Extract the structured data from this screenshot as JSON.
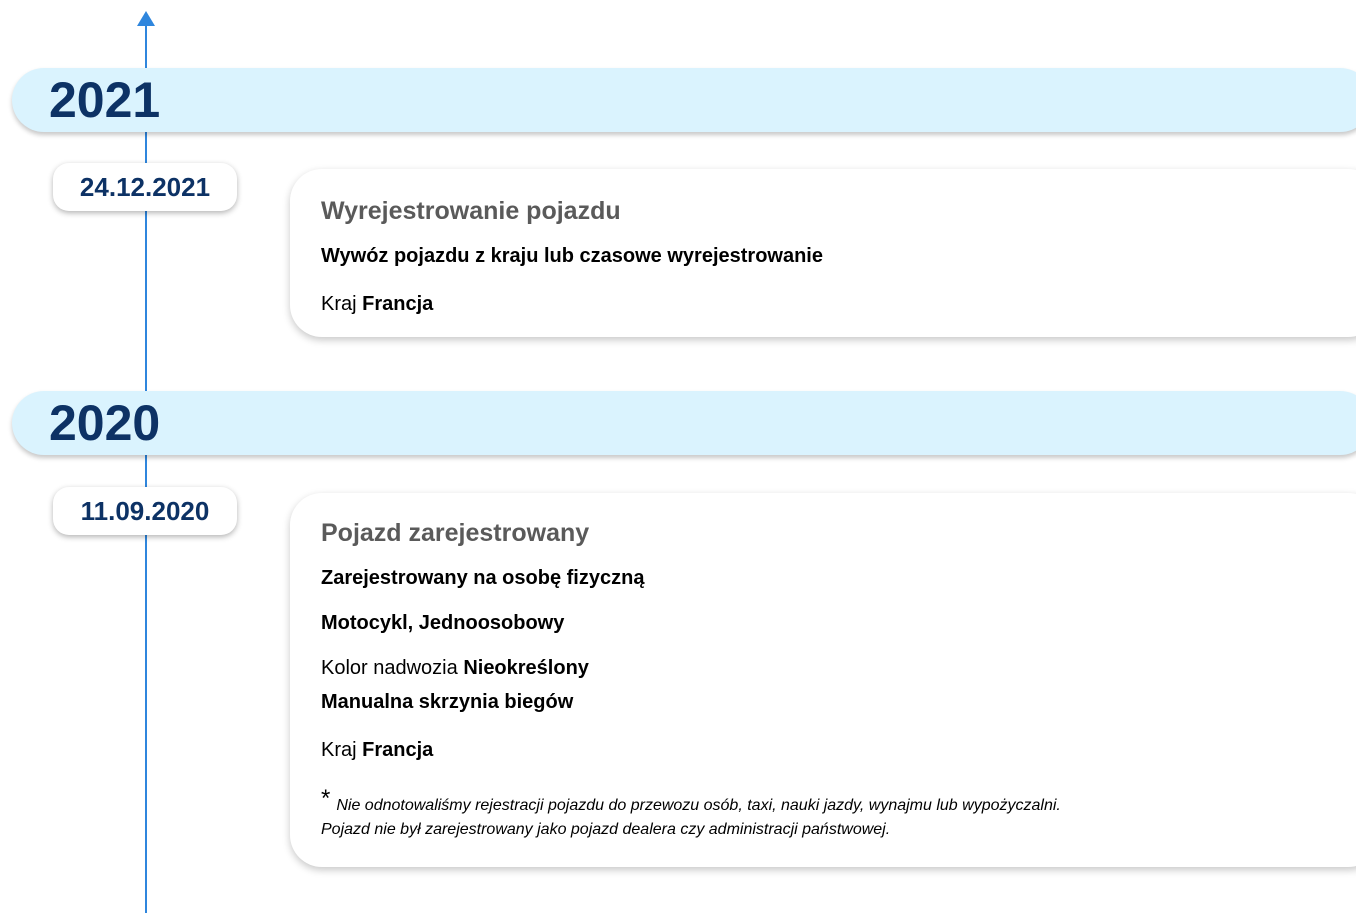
{
  "timeline": {
    "years": [
      {
        "year": "2021",
        "events": [
          {
            "date": "24.12.2021",
            "title": "Wyrejestrowanie pojazdu",
            "line1": "Wywóz pojazdu z kraju lub czasowe wyrejestrowanie",
            "country_label": "Kraj",
            "country_value": "Francja"
          }
        ]
      },
      {
        "year": "2020",
        "events": [
          {
            "date": "11.09.2020",
            "title": "Pojazd zarejestrowany",
            "line1": "Zarejestrowany na osobę fizyczną",
            "line2": "Motocykl, Jednoosobowy",
            "color_label": "Kolor nadwozia",
            "color_value": "Nieokreślony",
            "gearbox": "Manualna skrzynia biegów",
            "country_label": "Kraj",
            "country_value": "Francja",
            "footnote_marker": "*",
            "footnote_line1": "Nie odnotowaliśmy rejestracji pojazdu do przewozu osób, taxi, nauki jazdy, wynajmu lub wypożyczalni.",
            "footnote_line2": "Pojazd nie był zarejestrowany jako pojazd dealera czy administracji państwowej."
          }
        ]
      }
    ]
  },
  "colors": {
    "accent": "#2f86dd",
    "year_bar_bg": "#daf3fe",
    "year_text": "#0d3265",
    "title_text": "#5a5a5a"
  },
  "icons": {
    "timeline_arrow": "arrow-up-icon"
  }
}
